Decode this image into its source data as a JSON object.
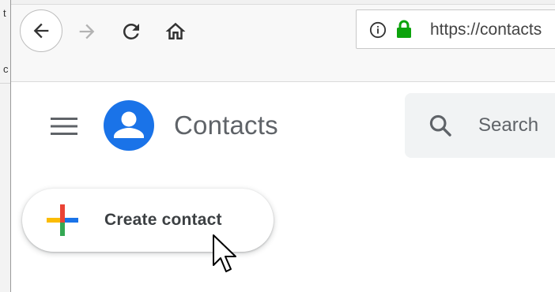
{
  "window": {
    "edge_fragments": [
      "t",
      "c"
    ]
  },
  "browser": {
    "address": {
      "url": "https://contacts"
    }
  },
  "app": {
    "title": "Contacts",
    "search": {
      "placeholder": "Search"
    },
    "create_button": {
      "label": "Create contact"
    }
  },
  "colors": {
    "google_blue": "#1a73e8",
    "google_red": "#ea4335",
    "google_yellow": "#fbbc04",
    "google_green": "#34a853",
    "lock_green": "#0ca30c",
    "icon_gray": "#5f6368"
  },
  "icons": [
    "back-arrow-icon",
    "forward-arrow-icon",
    "reload-icon",
    "home-icon",
    "info-icon",
    "lock-icon",
    "hamburger-menu-icon",
    "contacts-logo-icon",
    "search-icon",
    "plus-icon",
    "mouse-cursor-icon"
  ]
}
